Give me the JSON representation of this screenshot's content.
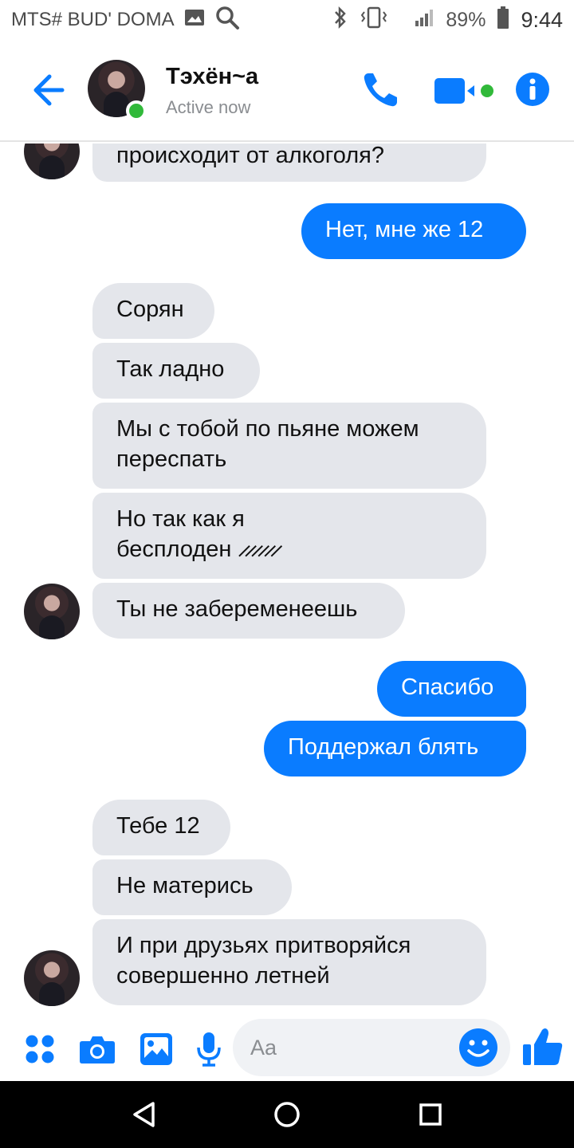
{
  "status_bar": {
    "carrier": "MTS# BUD' DOMA",
    "battery": "89%",
    "time": "9:44"
  },
  "header": {
    "contact_name": "Тэхён~а",
    "status": "Active now"
  },
  "messages": [
    {
      "side": "in",
      "text": "происходит от алкоголя?"
    },
    {
      "side": "out",
      "text": "Нет, мне же 12"
    },
    {
      "side": "in",
      "text": "Сорян"
    },
    {
      "side": "in",
      "text": "Так ладно"
    },
    {
      "side": "in",
      "text": "Мы с тобой по пьяне можем\nпереспать"
    },
    {
      "side": "in",
      "text": "Но так как я\nбесплоден  ̷ ̷ ̷ ̷ ̷ ̷"
    },
    {
      "side": "in",
      "text": "Ты не забеременеешь"
    },
    {
      "side": "out",
      "text": "Спасибо"
    },
    {
      "side": "out",
      "text": "Поддержал блять"
    },
    {
      "side": "in",
      "text": "Тебе 12"
    },
    {
      "side": "in",
      "text": "Не матерись"
    },
    {
      "side": "in",
      "text": "И при друзьях притворяйся\nсовершенно летней"
    }
  ],
  "composer": {
    "placeholder": "Aa"
  },
  "colors": {
    "accent": "#0a7cff",
    "incoming_bubble": "#e4e6eb",
    "online": "#31b93a"
  },
  "icons": {
    "back": "arrow-left-icon",
    "call": "phone-icon",
    "video": "video-camera-icon",
    "info": "info-icon",
    "apps": "four-dots-icon",
    "camera": "camera-icon",
    "gallery": "image-icon",
    "mic": "microphone-icon",
    "emoji": "smile-icon",
    "like": "thumbs-up-icon"
  }
}
